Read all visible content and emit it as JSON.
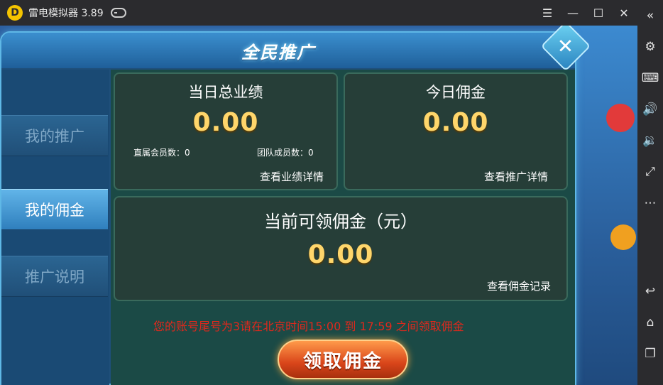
{
  "window": {
    "app_title": "雷电模拟器 3.89",
    "logo_icon": "leidian-logo",
    "controls": [
      "menu-icon",
      "minimize-icon",
      "maximize-icon",
      "close-icon"
    ]
  },
  "toolbar": {
    "items": [
      "collapse-icon",
      "gear-icon",
      "keyboard-icon",
      "volume-up-icon",
      "volume-down-icon",
      "fullscreen-icon",
      "more-icon",
      "back-icon",
      "home-icon",
      "recents-icon"
    ]
  },
  "dialog": {
    "title": "全民推广",
    "close_icon": "close-icon",
    "tabs": [
      {
        "label": "我的推广",
        "active": false
      },
      {
        "label": "我的佣金",
        "active": true
      },
      {
        "label": "推广说明",
        "active": false
      }
    ],
    "cards": {
      "performance": {
        "title": "当日总业绩",
        "amount": "0.00",
        "direct_members": "直属会员数：0",
        "team_members": "团队成员数：0",
        "link": "查看业绩详情"
      },
      "today": {
        "title": "今日佣金",
        "amount": "0.00",
        "link": "查看推广详情"
      },
      "claimable": {
        "title": "当前可领佣金（元）",
        "amount": "0.00",
        "link": "查看佣金记录"
      }
    },
    "notice": "您的账号尾号为3请在北京时间15:00 到 17:59 之间领取佣金",
    "claim_button": "领取佣金"
  },
  "colors": {
    "amount": "#ffd66b",
    "notice": "#e0281c",
    "button": "#d9451a"
  }
}
